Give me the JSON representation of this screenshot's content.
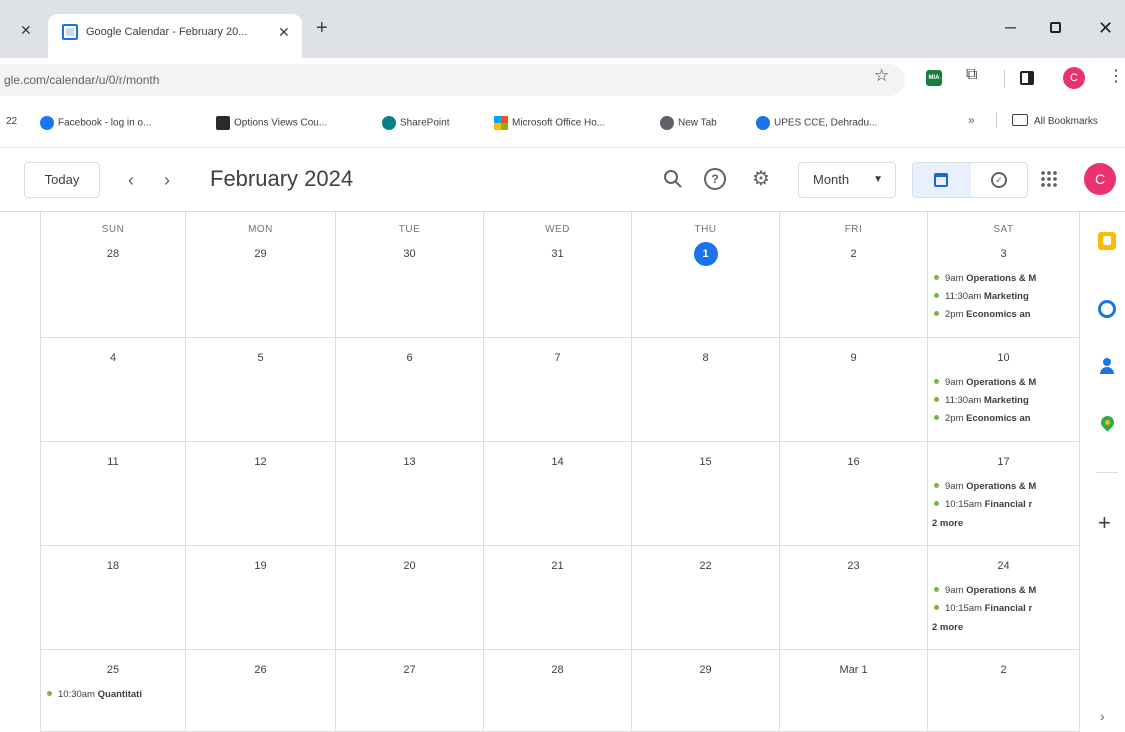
{
  "browser": {
    "tab_title": "Google Calendar - February 20...",
    "url": "gle.com/calendar/u/0/r/month",
    "ext_label": "MIA",
    "profile_initial": "C",
    "bookmarks_overflow_left": "22",
    "bookmarks": [
      {
        "label": "Facebook - log in o...",
        "icon": "facebook-icon"
      },
      {
        "label": "Options Views Cou...",
        "icon": "options-icon"
      },
      {
        "label": "SharePoint",
        "icon": "sharepoint-icon"
      },
      {
        "label": "Microsoft Office Ho...",
        "icon": "microsoft-icon"
      },
      {
        "label": "New Tab",
        "icon": "newtab-icon"
      },
      {
        "label": "UPES CCE, Dehradu...",
        "icon": "upes-icon"
      }
    ],
    "all_bookmarks": "All Bookmarks"
  },
  "header": {
    "today_label": "Today",
    "month_title": "February 2024",
    "view_select": "Month",
    "avatar_initial": "C"
  },
  "weekdays": [
    "SUN",
    "MON",
    "TUE",
    "WED",
    "THU",
    "FRI",
    "SAT"
  ],
  "weeks": [
    {
      "days": [
        {
          "num": "28",
          "events": []
        },
        {
          "num": "29",
          "events": []
        },
        {
          "num": "30",
          "events": []
        },
        {
          "num": "31",
          "events": []
        },
        {
          "num": "1",
          "today": true,
          "events": []
        },
        {
          "num": "2",
          "events": []
        },
        {
          "num": "3",
          "events": [
            {
              "time": "9am",
              "title": "Operations & M"
            },
            {
              "time": "11:30am",
              "title": "Marketing"
            },
            {
              "time": "2pm",
              "title": "Economics an"
            }
          ]
        }
      ]
    },
    {
      "days": [
        {
          "num": "4",
          "events": []
        },
        {
          "num": "5",
          "events": []
        },
        {
          "num": "6",
          "events": []
        },
        {
          "num": "7",
          "events": []
        },
        {
          "num": "8",
          "events": []
        },
        {
          "num": "9",
          "events": []
        },
        {
          "num": "10",
          "events": [
            {
              "time": "9am",
              "title": "Operations & M"
            },
            {
              "time": "11:30am",
              "title": "Marketing"
            },
            {
              "time": "2pm",
              "title": "Economics an"
            }
          ]
        }
      ]
    },
    {
      "days": [
        {
          "num": "11",
          "events": []
        },
        {
          "num": "12",
          "events": []
        },
        {
          "num": "13",
          "events": []
        },
        {
          "num": "14",
          "events": []
        },
        {
          "num": "15",
          "events": []
        },
        {
          "num": "16",
          "events": []
        },
        {
          "num": "17",
          "events": [
            {
              "time": "9am",
              "title": "Operations & M"
            },
            {
              "time": "10:15am",
              "title": "Financial r"
            }
          ],
          "more": "2 more"
        }
      ]
    },
    {
      "days": [
        {
          "num": "18",
          "events": []
        },
        {
          "num": "19",
          "events": []
        },
        {
          "num": "20",
          "events": []
        },
        {
          "num": "21",
          "events": []
        },
        {
          "num": "22",
          "events": []
        },
        {
          "num": "23",
          "events": []
        },
        {
          "num": "24",
          "events": [
            {
              "time": "9am",
              "title": "Operations & M"
            },
            {
              "time": "10:15am",
              "title": "Financial r"
            }
          ],
          "more": "2 more"
        }
      ]
    },
    {
      "days": [
        {
          "num": "25",
          "events": [
            {
              "time": "10:30am",
              "title": "Quantitati"
            }
          ]
        },
        {
          "num": "26",
          "events": []
        },
        {
          "num": "27",
          "events": []
        },
        {
          "num": "28",
          "events": []
        },
        {
          "num": "29",
          "events": []
        },
        {
          "num": "Mar 1",
          "events": []
        },
        {
          "num": "2",
          "events": []
        }
      ]
    }
  ],
  "colors": {
    "accent": "#1a73e8",
    "event_dot": "#7cb342",
    "avatar": "#e8336e"
  }
}
